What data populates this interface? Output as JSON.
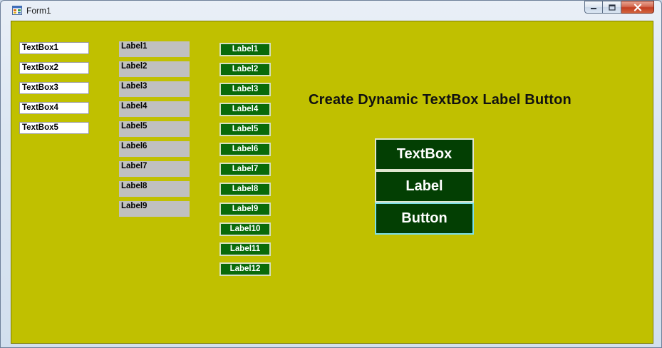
{
  "window": {
    "title": "Form1",
    "form_backcolor": "#c0c000"
  },
  "textboxes": [
    "TextBox1",
    "TextBox2",
    "TextBox3",
    "TextBox4",
    "TextBox5"
  ],
  "labels": [
    "Label1",
    "Label2",
    "Label3",
    "Label4",
    "Label5",
    "Label6",
    "Label7",
    "Label8",
    "Label9"
  ],
  "label_buttons": [
    "Label1",
    "Label2",
    "Label3",
    "Label4",
    "Label5",
    "Label6",
    "Label7",
    "Label8",
    "Label9",
    "Label10",
    "Label11",
    "Label12"
  ],
  "heading": "Create Dynamic TextBox Label Button",
  "actions": {
    "textbox_label": "TextBox",
    "label_label": "Label",
    "button_label": "Button"
  }
}
